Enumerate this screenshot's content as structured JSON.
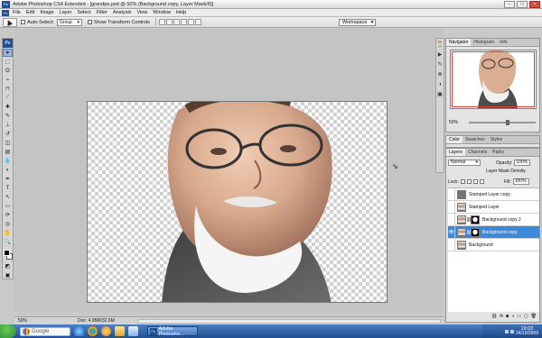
{
  "titlebar": {
    "title": "Adobe Photoshop CS4 Extended - [grandpa.psd @ 50% (Background copy, Layer Mask/8)]"
  },
  "menubar": {
    "items": [
      "File",
      "Edit",
      "Image",
      "Layer",
      "Select",
      "Filter",
      "Analysis",
      "View",
      "Window",
      "Help"
    ]
  },
  "options": {
    "auto_select_label": "Auto-Select:",
    "auto_select_value": "Group",
    "show_transform_label": "Show Transform Controls",
    "workspace_label": "Workspace"
  },
  "panels": {
    "navigator_tabs": [
      "Navigator",
      "Histogram",
      "Info"
    ],
    "navigator_zoom": "50%",
    "color_tabs": [
      "Color",
      "Swatches",
      "Styles"
    ],
    "layers_tabs": [
      "Layers",
      "Channels",
      "Paths"
    ],
    "blend_mode": "Normal",
    "opacity_label": "Opacity:",
    "opacity_value": "100%",
    "mask_density_label": "Layer Mask Density",
    "lock_label": "Lock:",
    "fill_label": "Fill:",
    "fill_value": "100%",
    "layers": [
      {
        "name": "Stamped Layer copy",
        "selected": false
      },
      {
        "name": "Stamped Layer",
        "selected": false
      },
      {
        "name": "Background copy 2",
        "selected": false
      },
      {
        "name": "Background copy",
        "selected": true
      },
      {
        "name": "Background",
        "selected": false
      }
    ]
  },
  "status": {
    "zoom": "50%",
    "doc": "Doc: 4.95M/32.6M"
  },
  "taskbar": {
    "search_label": "Google",
    "app_button_label": "Adobe Photosho...",
    "time": "19:02",
    "date": "24/10/2009"
  },
  "colors": {
    "selected_layer": "#3d88d8",
    "navigator_view_box": "#e13b3b"
  }
}
